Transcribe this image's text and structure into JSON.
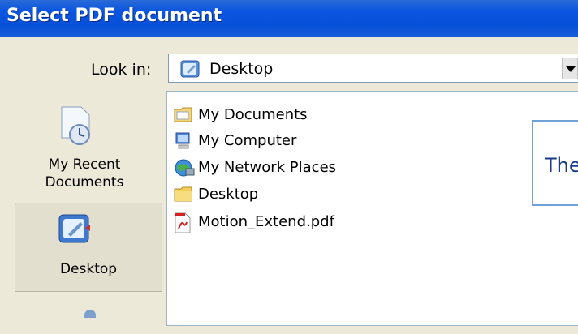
{
  "window": {
    "title": "Select PDF document"
  },
  "lookin": {
    "label": "Look in:",
    "value": "Desktop"
  },
  "places": {
    "recent": {
      "label_line1": "My Recent",
      "label_line2": "Documents"
    },
    "desktop": {
      "label": "Desktop"
    }
  },
  "files": [
    {
      "name": "My Documents",
      "icon": "folder-documents-icon"
    },
    {
      "name": "My Computer",
      "icon": "computer-icon"
    },
    {
      "name": "My Network Places",
      "icon": "network-places-icon"
    },
    {
      "name": "Desktop",
      "icon": "folder-icon"
    },
    {
      "name": "Motion_Extend.pdf",
      "icon": "pdf-file-icon"
    }
  ],
  "preview": {
    "text": "The"
  }
}
